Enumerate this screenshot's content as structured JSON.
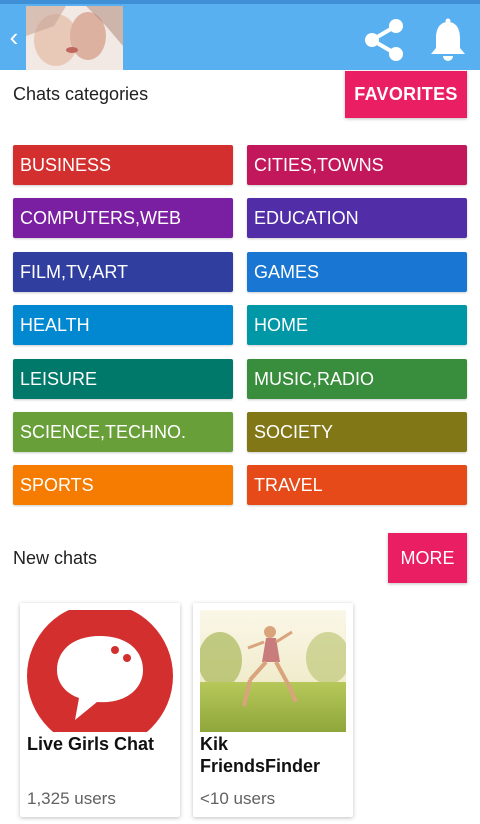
{
  "header": {
    "back_icon": "chevron-left-icon",
    "avatar_alt": "profile photo",
    "share_icon": "share-icon",
    "notification_icon": "bell-icon",
    "background_color": "#58b0f1"
  },
  "categories_section": {
    "title": "Chats categories",
    "favorites_label": "FAVORITES",
    "items": [
      {
        "label": "BUSINESS",
        "color": "#d32f2f"
      },
      {
        "label": "CITIES,TOWNS",
        "color": "#c2185b"
      },
      {
        "label": "COMPUTERS,WEB",
        "color": "#7b1fa2"
      },
      {
        "label": "EDUCATION",
        "color": "#512da8"
      },
      {
        "label": "FILM,TV,ART",
        "color": "#303f9f"
      },
      {
        "label": "GAMES",
        "color": "#1976d2"
      },
      {
        "label": "HEALTH",
        "color": "#0288d1"
      },
      {
        "label": "HOME",
        "color": "#0097a7"
      },
      {
        "label": "LEISURE",
        "color": "#00796b"
      },
      {
        "label": "MUSIC,RADIO",
        "color": "#388e3c"
      },
      {
        "label": "SCIENCE,TECHNO.",
        "color": "#689f38"
      },
      {
        "label": "SOCIETY",
        "color": "#827717"
      },
      {
        "label": "SPORTS",
        "color": "#f57c00"
      },
      {
        "label": "TRAVEL",
        "color": "#e64a19"
      }
    ]
  },
  "new_chats_section": {
    "title": "New chats",
    "more_label": "MORE",
    "cards": [
      {
        "title": "Live Girls Chat",
        "users": "1,325 users",
        "image": "speech-bubble-logo"
      },
      {
        "title": "Kik FriendsFinder",
        "users": "<10 users",
        "image": "girl-running-in-field-photo"
      }
    ]
  },
  "accent_color": "#e91e63"
}
